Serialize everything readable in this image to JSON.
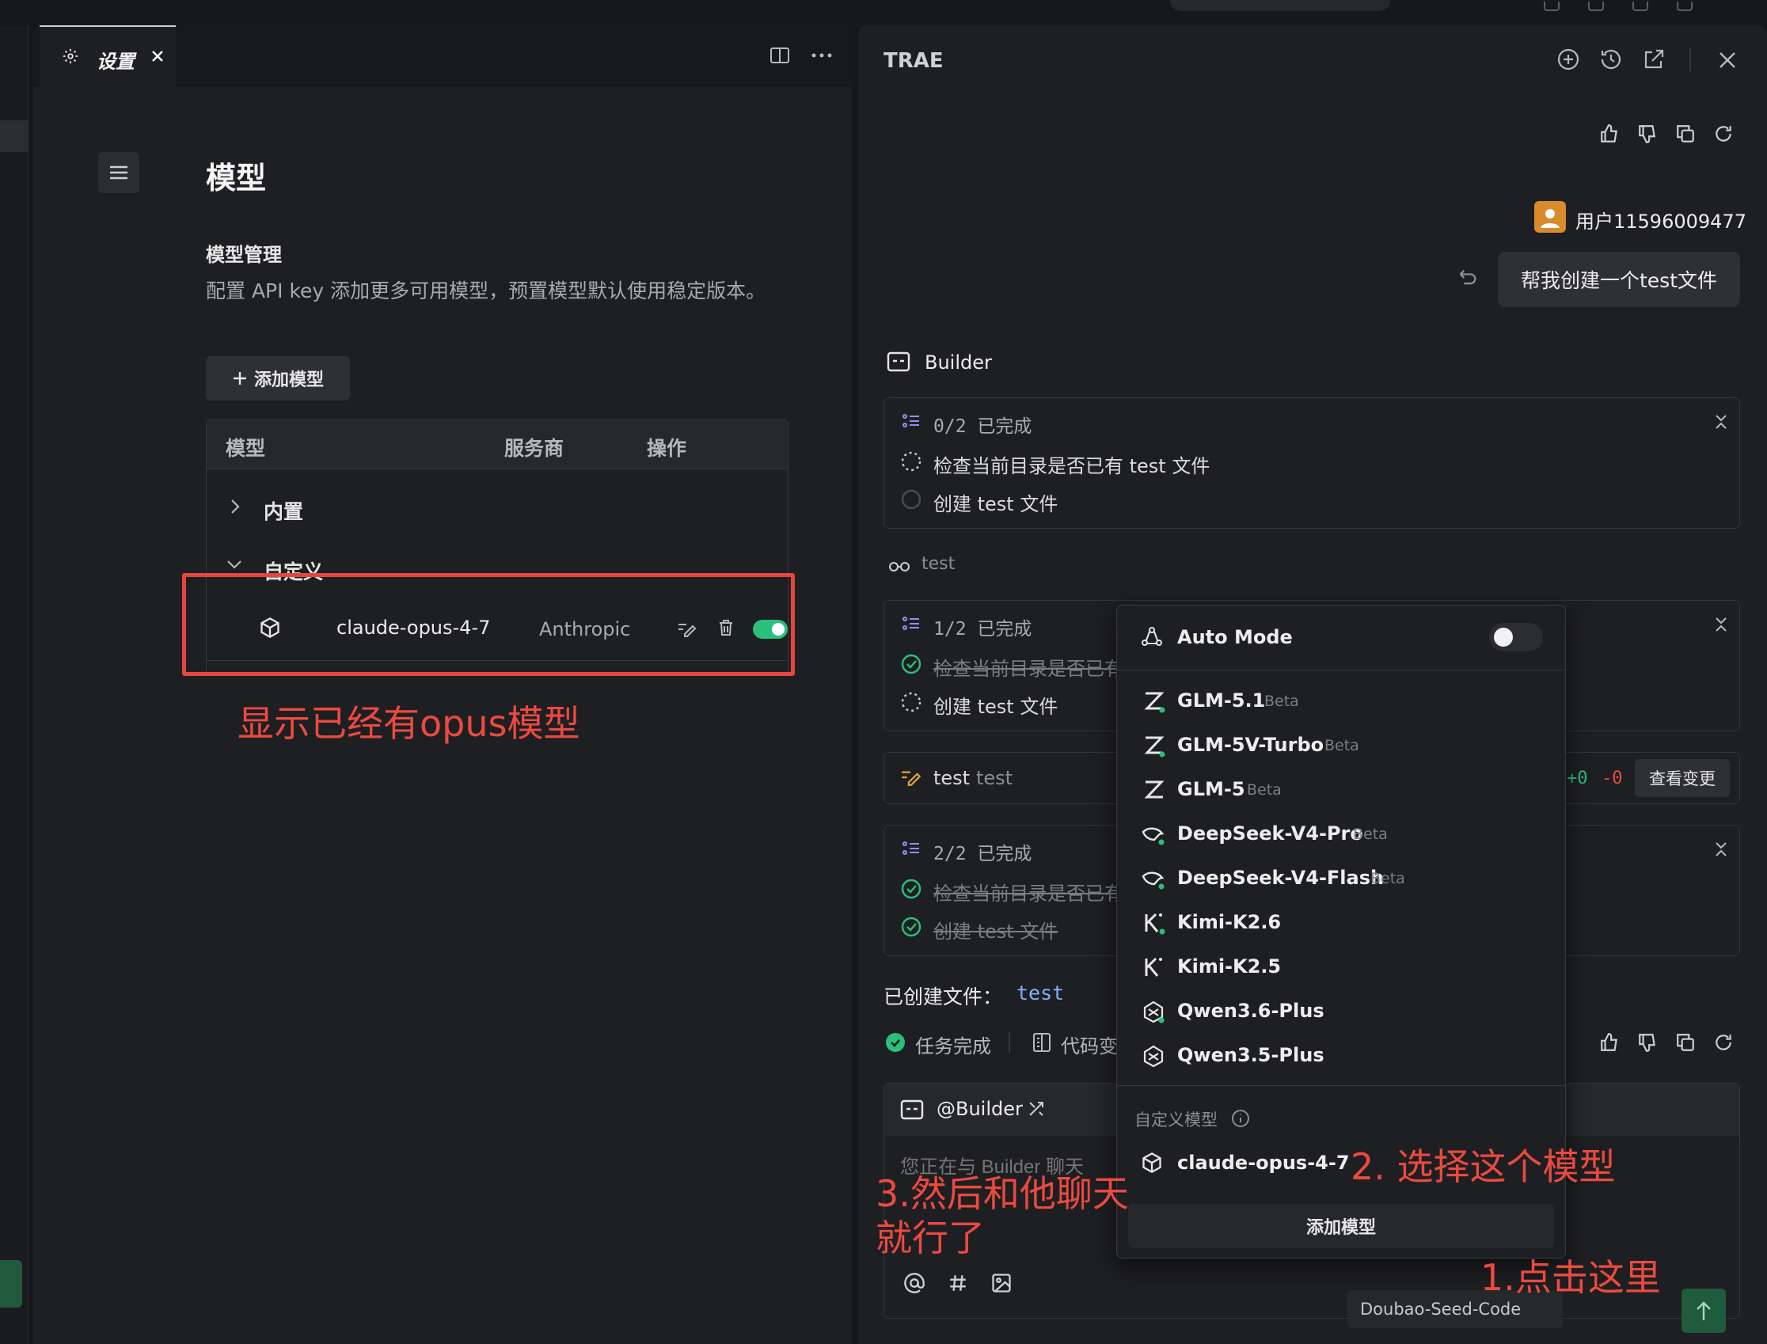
{
  "settings": {
    "tab_label": "设置",
    "page_title": "模型",
    "section_title": "模型管理",
    "section_desc": "配置 API key 添加更多可用模型，预置模型默认使用稳定版本。",
    "add_model_label": "添加模型",
    "table": {
      "headers": [
        "模型",
        "服务商",
        "操作"
      ],
      "group_builtin": "内置",
      "group_custom": "自定义",
      "row": {
        "model": "claude-opus-4-7",
        "provider": "Anthropic",
        "enabled": true
      }
    }
  },
  "annotations": {
    "note1": "显示已经有opus模型",
    "note2": "2. 选择这个模型",
    "note3_line1": "3.然后和他聊天",
    "note3_line2": "就行了",
    "note4": "1.点击这里"
  },
  "chat": {
    "title": "TRAE",
    "user_name": "用户11596009477",
    "user_message": "帮我创建一个test文件",
    "agent_name": "Builder",
    "plan1": {
      "progress": "0/2 已完成",
      "tasks": [
        "检查当前目录是否已有 test 文件",
        "创建 test 文件"
      ]
    },
    "thought_label": "test",
    "plan2": {
      "progress": "1/2 已完成",
      "tasks": [
        "检查当前目录是否已有",
        "创建 test 文件"
      ]
    },
    "edit_file": "test",
    "edit_path": "test",
    "diff_add": "+0",
    "diff_del": "-0",
    "view_changes": "查看变更",
    "plan3": {
      "progress": "2/2 已完成",
      "tasks": [
        "检查当前目录是否已有",
        "创建 test 文件"
      ]
    },
    "created_label": "已创建文件：",
    "created_file": "test",
    "task_done": "任务完成",
    "code_changes": "代码变",
    "input_agent": "@Builder",
    "input_placeholder": "您正在与 Builder 聊天",
    "current_model": "Doubao-Seed-Code"
  },
  "dropdown": {
    "auto_mode": "Auto Mode",
    "auto_mode_on": false,
    "models": [
      {
        "name": "GLM-5.1",
        "badge": "Beta",
        "icon": "zhipu-icon"
      },
      {
        "name": "GLM-5V-Turbo",
        "badge": "Beta",
        "icon": "zhipu-icon"
      },
      {
        "name": "GLM-5",
        "badge": "Beta",
        "icon": "zhipu-icon"
      },
      {
        "name": "DeepSeek-V4-Pro",
        "badge": "Beta",
        "icon": "deepseek-icon"
      },
      {
        "name": "DeepSeek-V4-Flash",
        "badge": "Beta",
        "icon": "deepseek-icon"
      },
      {
        "name": "Kimi-K2.6",
        "badge": "",
        "icon": "kimi-icon"
      },
      {
        "name": "Kimi-K2.5",
        "badge": "",
        "icon": "kimi-icon"
      },
      {
        "name": "Qwen3.6-Plus",
        "badge": "",
        "icon": "qwen-icon"
      },
      {
        "name": "Qwen3.5-Plus",
        "badge": "",
        "icon": "qwen-icon"
      }
    ],
    "custom_label": "自定义模型",
    "custom_model": "claude-opus-4-7",
    "add_model": "添加模型"
  },
  "colors": {
    "accent_green": "#2bbf7c",
    "annotation_red": "#ec4a3f",
    "link_blue": "#7fb3ff"
  }
}
